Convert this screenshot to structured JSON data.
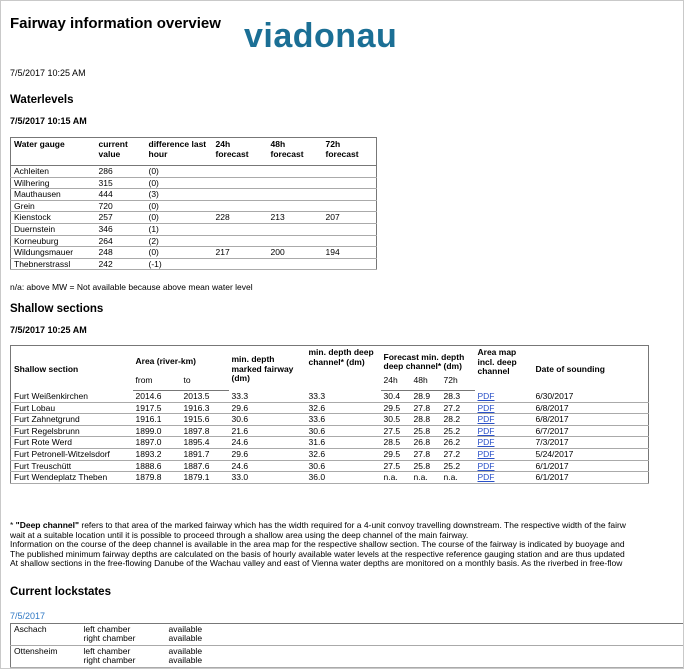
{
  "header": {
    "title": "Fairway information overview",
    "logo": "viadonau",
    "timestamp": "7/5/2017 10:25 AM"
  },
  "waterlevels": {
    "heading": "Waterlevels",
    "timestamp": "7/5/2017 10:15 AM",
    "columns": [
      "Water gauge",
      "current value",
      "difference last hour",
      "24h forecast",
      "48h forecast",
      "72h forecast"
    ],
    "rows": [
      [
        "Achleiten",
        "286",
        "(0)",
        "",
        "",
        ""
      ],
      [
        "Wilhering",
        "315",
        "(0)",
        "",
        "",
        ""
      ],
      [
        "Mauthausen",
        "444",
        "(3)",
        "",
        "",
        ""
      ],
      [
        "Grein",
        "720",
        "(0)",
        "",
        "",
        ""
      ],
      [
        "Kienstock",
        "257",
        "(0)",
        "228",
        "213",
        "207"
      ],
      [
        "Duernstein",
        "346",
        "(1)",
        "",
        "",
        ""
      ],
      [
        "Korneuburg",
        "264",
        "(2)",
        "",
        "",
        ""
      ],
      [
        "Wildungsmauer",
        "248",
        "(0)",
        "217",
        "200",
        "194"
      ],
      [
        "Thebnerstrassl",
        "242",
        "(-1)",
        "",
        "",
        ""
      ]
    ],
    "note": "n/a: above MW = Not available because above mean water level"
  },
  "shallow": {
    "heading": "Shallow sections",
    "timestamp": "7/5/2017 10:25 AM",
    "headers": {
      "section": "Shallow section",
      "area": "Area (river-km)",
      "from": "from",
      "to": "to",
      "min_fairway": "min. depth marked fairway (dm)",
      "min_deep": "min. depth deep channel* (dm)",
      "forecast": "Forecast min. depth deep channel* (dm)",
      "f24": "24h",
      "f48": "48h",
      "f72": "72h",
      "map": "Area map incl. deep channel",
      "date": "Date of sounding"
    },
    "rows": [
      [
        "Furt Weißenkirchen",
        "2014.6",
        "2013.5",
        "33.3",
        "33.3",
        "30.4",
        "28.9",
        "28.3",
        "PDF",
        "6/30/2017"
      ],
      [
        "Furt Lobau",
        "1917.5",
        "1916.3",
        "29.6",
        "32.6",
        "29.5",
        "27.8",
        "27.2",
        "PDF",
        "6/8/2017"
      ],
      [
        "Furt Zahnetgrund",
        "1916.1",
        "1915.6",
        "30.6",
        "33.6",
        "30.5",
        "28.8",
        "28.2",
        "PDF",
        "6/8/2017"
      ],
      [
        "Furt Regelsbrunn",
        "1899.0",
        "1897.8",
        "21.6",
        "30.6",
        "27.5",
        "25.8",
        "25.2",
        "PDF",
        "6/7/2017"
      ],
      [
        "Furt Rote Werd",
        "1897.0",
        "1895.4",
        "24.6",
        "31.6",
        "28.5",
        "26.8",
        "26.2",
        "PDF",
        "7/3/2017"
      ],
      [
        "Furt Petronell-Witzelsdorf",
        "1893.2",
        "1891.7",
        "29.6",
        "32.6",
        "29.5",
        "27.8",
        "27.2",
        "PDF",
        "5/24/2017"
      ],
      [
        "Furt Treuschütt",
        "1888.6",
        "1887.6",
        "24.6",
        "30.6",
        "27.5",
        "25.8",
        "25.2",
        "PDF",
        "6/1/2017"
      ],
      [
        "Furt Wendeplatz Theben",
        "1879.8",
        "1879.1",
        "33.0",
        "36.0",
        "n.a.",
        "n.a.",
        "n.a.",
        "PDF",
        "6/1/2017"
      ]
    ],
    "footnote": {
      "star": "* ",
      "term": "\"Deep channel\"",
      "line1": " refers to that area of the marked fairway which has the width required for a 4-unit convoy travelling downstream. The respective width of the fairw",
      "line2": "wait at a suitable location until it is possible to proceed through a shallow area using the deep channel of the main fairway.",
      "line3": "Information on the course of the deep channel is available in the area map for the respective shallow section. The course of the fairway is indicated by buoyage and",
      "line4": "The published minimum fairway depths are calculated on the basis of hourly available water levels at the respective reference gauging station and are thus updated",
      "line5": "At shallow sections in the free-flowing Danube of the Wachau valley and east of Vienna water depths are monitored on a monthly basis. As the riverbed in free-flow"
    }
  },
  "lockstates": {
    "heading": "Current lockstates",
    "date": "7/5/2017",
    "rows": [
      {
        "lock": "Aschach",
        "left": "left chamber",
        "right": "right chamber",
        "left_state": "available",
        "right_state": "available"
      },
      {
        "lock": "Ottensheim",
        "left": "left chamber",
        "right": "right chamber",
        "left_state": "available",
        "right_state": "available"
      }
    ]
  }
}
